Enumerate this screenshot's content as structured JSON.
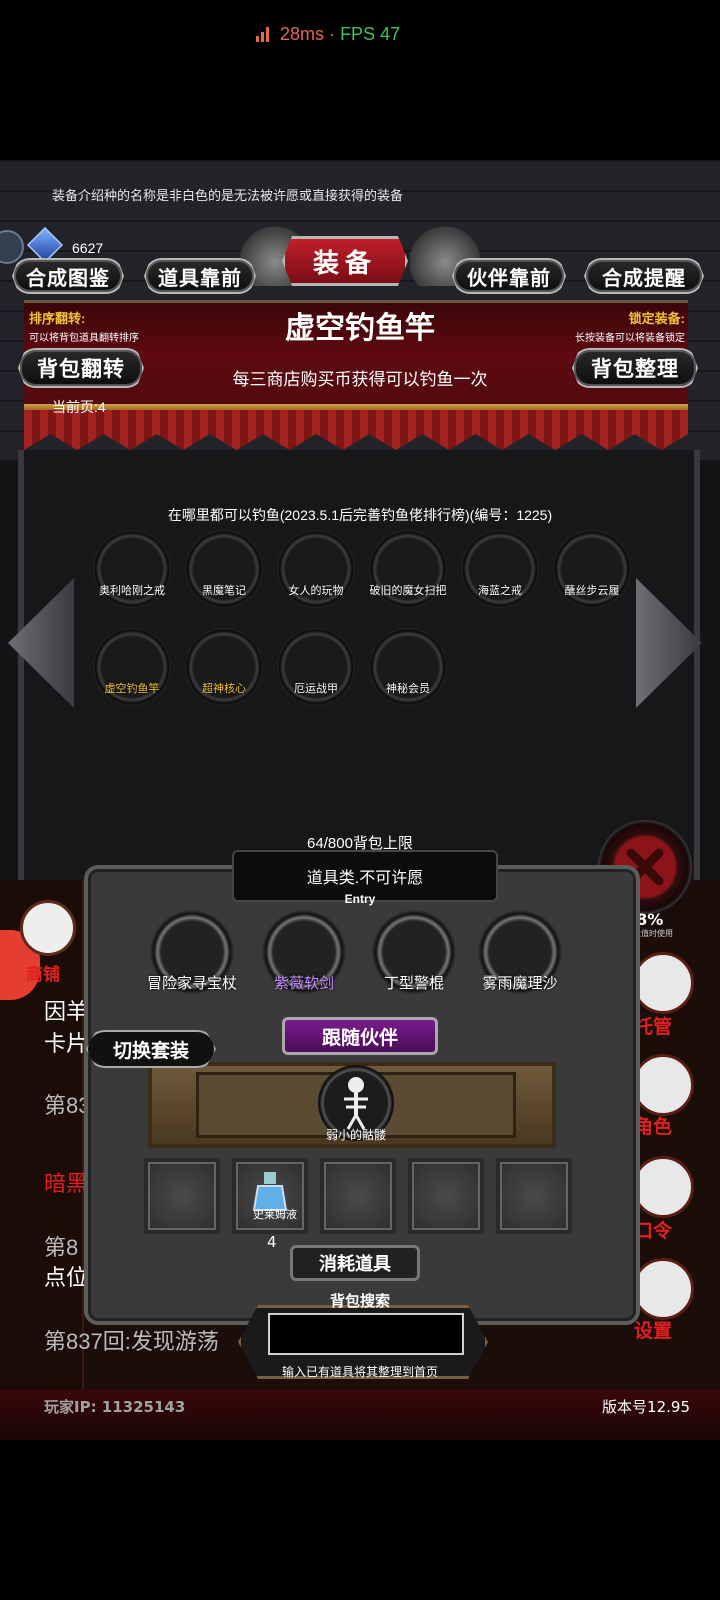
{
  "status": {
    "ping": "28ms",
    "sep": "·",
    "fps": "FPS 47"
  },
  "header": {
    "tip": "装备介绍种的名称是非白色的是无法被许愿或直接获得的装备",
    "currency": "6627",
    "tabs": [
      "合成图鉴",
      "道具靠前",
      "装备",
      "伙伴靠前",
      "合成提醒"
    ]
  },
  "detail": {
    "sort_label": "排序翻转:",
    "sort_sub": "可以将背包道具翻转排序",
    "lock_label": "锁定装备:",
    "lock_sub": "长按装备可以将装备锁定",
    "item_name": "虚空钓鱼竿",
    "item_desc": "每三商店购买币获得可以钓鱼一次",
    "flip_btn": "背包翻转",
    "sort_btn": "背包整理",
    "page": "当前页:4"
  },
  "set": {
    "title": "在哪里都可以钓鱼(2023.5.1后完善钓鱼佬排行榜)(编号：1225)",
    "items": [
      {
        "label": "奥利哈刚之戒",
        "color": "#ffffff"
      },
      {
        "label": "黑魔笔记",
        "color": "#ffffff"
      },
      {
        "label": "女人的玩物",
        "color": "#ffffff"
      },
      {
        "label": "破旧的魔女扫把",
        "color": "#ffffff"
      },
      {
        "label": "海蓝之戒",
        "color": "#ffffff"
      },
      {
        "label": "蘸丝步云履",
        "color": "#ffffff"
      },
      {
        "label": "虚空钓鱼竿",
        "color": "#f0c23a"
      },
      {
        "label": "超神核心",
        "color": "#f0c23a"
      },
      {
        "label": "厄运战甲",
        "color": "#ffffff"
      },
      {
        "label": "神秘会员",
        "color": "#ffffff"
      }
    ]
  },
  "background": {
    "shop_label": "商铺",
    "lines": [
      "因羊",
      "卡片",
      "第83",
      "暗黑",
      "第8",
      "点位",
      "第837回:发现游荡"
    ],
    "right_labels": [
      "托管",
      "角色",
      "口令",
      "设置"
    ],
    "pct": "98%",
    "pct_sub": "其数值时使用"
  },
  "inventory": {
    "capacity": "64/800背包上限",
    "category": "道具类.不可许愿",
    "entry": "Entry",
    "weapons": [
      {
        "label": "冒险家寻宝杖",
        "color": "#ffffff"
      },
      {
        "label": "紫薇软剑",
        "color": "#c68cff"
      },
      {
        "label": "丁型警棍",
        "color": "#ffffff"
      },
      {
        "label": "雾雨魔理沙",
        "color": "#ffffff"
      }
    ],
    "switch_btn": "切换套装",
    "follow_btn": "跟随伙伴",
    "pet": "弱小的骷髅",
    "consumable": {
      "label": "史莱姆液",
      "qty": "4"
    },
    "consume_btn": "消耗道具",
    "search_label": "背包搜索",
    "search_placeholder": "",
    "search_hint": "输入已有道具将其整理到首页"
  },
  "footer": {
    "ip": "玩家IP: 11325143",
    "version": "版本号12.95"
  }
}
